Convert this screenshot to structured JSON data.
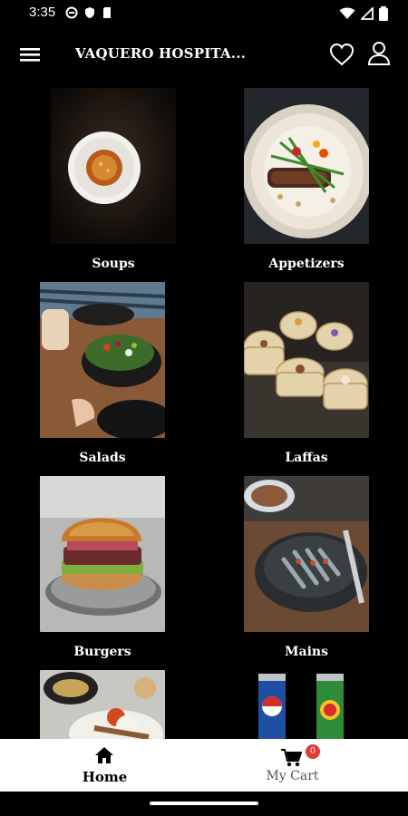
{
  "status_bar": {
    "time": "3:35"
  },
  "app_bar": {
    "title": "VAQUERO HOSPITA..."
  },
  "categories": [
    {
      "label": "Soups",
      "icon": "soup-bowl-photo"
    },
    {
      "label": "Appetizers",
      "icon": "appetizer-plate-photo"
    },
    {
      "label": "Salads",
      "icon": "salad-bowl-photo"
    },
    {
      "label": "Laffas",
      "icon": "laffa-wraps-photo"
    },
    {
      "label": "Burgers",
      "icon": "burger-photo"
    },
    {
      "label": "Mains",
      "icon": "mains-dish-photo"
    }
  ],
  "bottom_nav": {
    "home_label": "Home",
    "cart_label": "My Cart",
    "cart_count": "0"
  },
  "colors": {
    "background": "#000000",
    "nav_background": "#ffffff",
    "badge": "#e53935"
  }
}
